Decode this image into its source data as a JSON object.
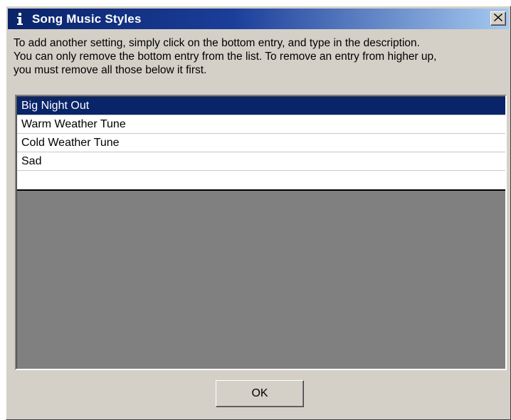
{
  "window": {
    "title": "Song Music Styles",
    "title_icon": "info-icon",
    "close_icon": "close-icon"
  },
  "instructions": {
    "lines": [
      "To add another setting, simply click on the bottom entry, and type in the description.",
      "You can only remove the bottom entry from the list. To remove an entry from higher up,",
      "you must remove all those below it first."
    ]
  },
  "list": {
    "items": [
      "Big Night Out",
      "Warm Weather Tune",
      "Cold Weather Tune",
      "Sad",
      ""
    ],
    "selected_index": 0
  },
  "buttons": {
    "ok_label": "OK"
  },
  "colors": {
    "title_gradient_start": "#0a246a",
    "title_gradient_end": "#a6caf0",
    "selection": "#0a246a",
    "dialog_face": "#d4d0c8",
    "list_background_empty": "#808080"
  }
}
